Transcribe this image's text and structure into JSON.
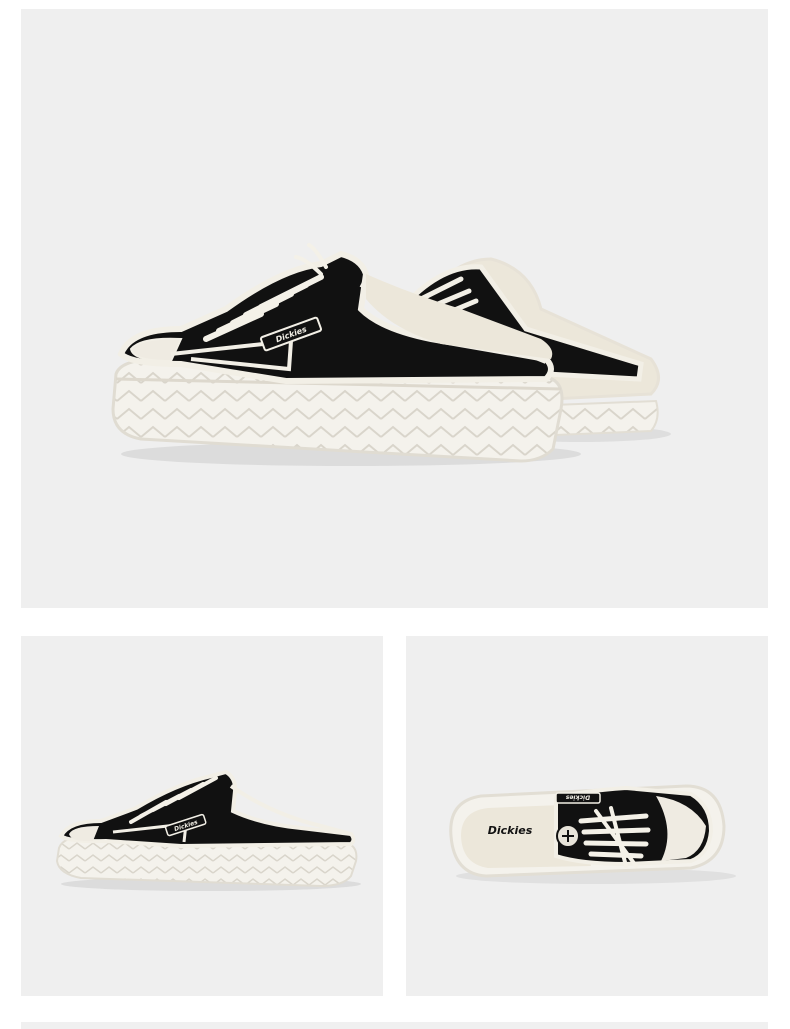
{
  "product": {
    "brand_mark": "Dickies",
    "colors": {
      "background_panel": "#efefef",
      "upper": "#111111",
      "trim": "#f2efe6",
      "sole": "#f4f2ec",
      "lining": "#ece7da"
    }
  },
  "panels": [
    {
      "id": "pair-angle-view",
      "icon": "shoe-pair-photo"
    },
    {
      "id": "side-view",
      "icon": "shoe-side-photo"
    },
    {
      "id": "top-view",
      "icon": "shoe-top-photo"
    }
  ]
}
